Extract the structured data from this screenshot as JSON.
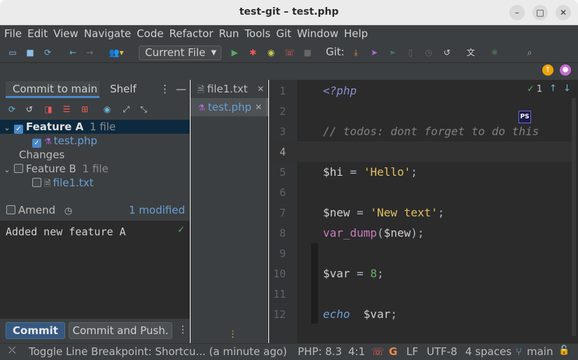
{
  "window": {
    "title": "test-git – test.php"
  },
  "menu": [
    "File",
    "Edit",
    "View",
    "Navigate",
    "Code",
    "Refactor",
    "Run",
    "Tools",
    "Git",
    "Window",
    "Help"
  ],
  "toolbar": {
    "run_config": "Current File",
    "git_label": "Git:"
  },
  "commit_panel": {
    "tab_commit": "Commit to main",
    "tab_shelf": "Shelf",
    "changelists": [
      {
        "name": "Feature A",
        "count": "1 file",
        "checked": true,
        "files": [
          {
            "name": "test.php",
            "checked": true
          }
        ]
      },
      {
        "name": "Changes"
      },
      {
        "name": "Feature B",
        "count": "1 file",
        "checked": false,
        "files": [
          {
            "name": "file1.txt",
            "checked": false
          }
        ]
      }
    ],
    "amend_label": "Amend",
    "modified_label": "1 modified",
    "message": "Added new feature A",
    "commit_button": "Commit",
    "commit_push_button": "Commit and Push."
  },
  "file_tabs": [
    {
      "name": "file1.txt"
    },
    {
      "name": "test.php"
    }
  ],
  "editor": {
    "inspection_count": "1",
    "lines": [
      {
        "n": "1",
        "text": "<?php"
      },
      {
        "n": "2",
        "text": ""
      },
      {
        "n": "3",
        "text": "// todos: dont forget to do this"
      },
      {
        "n": "4",
        "text": ""
      },
      {
        "n": "5",
        "text": "$hi = 'Hello';"
      },
      {
        "n": "6",
        "text": ""
      },
      {
        "n": "7",
        "text": "$new = 'New text';"
      },
      {
        "n": "8",
        "text": "var_dump($new);"
      },
      {
        "n": "9",
        "text": ""
      },
      {
        "n": "10",
        "text": "$var = 8;"
      },
      {
        "n": "11",
        "text": ""
      },
      {
        "n": "12",
        "text": "echo  $var;"
      }
    ]
  },
  "status": {
    "message": "Toggle Line Breakpoint: Shortcu... (a minute ago)",
    "php": "PHP: 8.3",
    "position": "4:1",
    "line_sep": "LF",
    "encoding": "UTF-8",
    "indent": "4 spaces",
    "branch": "main"
  },
  "colors": {
    "accent": "#4a88c7",
    "keyword": "#cc7832",
    "string": "#6a8759",
    "number": "#6897bb",
    "comment": "#808080",
    "function": "#9876aa"
  }
}
